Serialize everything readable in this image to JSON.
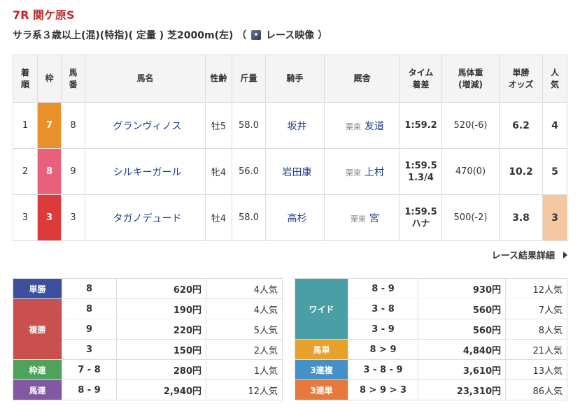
{
  "race": {
    "title": "7R 関ケ原S",
    "condition": "サラ系３歳以上(混)(特指)( 定量 ) 芝2000m(左) （",
    "video_label": "レース映像",
    "condition_close": "）"
  },
  "result_headers": {
    "chaku": [
      "着",
      "順"
    ],
    "waku": "枠",
    "umaban": [
      "馬",
      "番"
    ],
    "name": "馬名",
    "age": "性齢",
    "weight": "斤量",
    "jockey": "騎手",
    "stable": "厩舎",
    "time": [
      "タイム",
      "着差"
    ],
    "bw": [
      "馬体重",
      "(増減)"
    ],
    "odds": [
      "単勝",
      "オッズ"
    ],
    "pop": [
      "人",
      "気"
    ]
  },
  "results": [
    {
      "chaku": "1",
      "waku": "7",
      "waku_color": "#e8902c",
      "umaban": "8",
      "name": "グランヴィノス",
      "age": "牡5",
      "weight": "58.0",
      "jockey": "坂井",
      "region": "栗東",
      "trainer": "友道",
      "time": "1:59.2",
      "margin": "",
      "bw": "520(-6)",
      "odds": "6.2",
      "pop": "4",
      "pop_bg": ""
    },
    {
      "chaku": "2",
      "waku": "8",
      "waku_color": "#e8607a",
      "umaban": "9",
      "name": "シルキーガール",
      "age": "牝4",
      "weight": "56.0",
      "jockey": "岩田康",
      "region": "栗東",
      "trainer": "上村",
      "time": "1:59.5",
      "margin": "1.3/4",
      "bw": "470(0)",
      "odds": "10.2",
      "pop": "5",
      "pop_bg": ""
    },
    {
      "chaku": "3",
      "waku": "3",
      "waku_color": "#dd3b3b",
      "umaban": "3",
      "name": "タガノデュード",
      "age": "牡4",
      "weight": "58.0",
      "jockey": "高杉",
      "region": "栗東",
      "trainer": "宮",
      "time": "1:59.5",
      "margin": "ハナ",
      "bw": "500(-2)",
      "odds": "3.8",
      "pop": "3",
      "pop_bg": "#f4c7a1"
    }
  ],
  "detail_link": "レース結果詳細",
  "payouts_left": [
    {
      "type": "単勝",
      "color": "#3f4fa0",
      "rows": [
        {
          "combo": "8",
          "amount": "620円",
          "ninki": "4人気"
        }
      ]
    },
    {
      "type": "複勝",
      "color": "#c9504f",
      "rows": [
        {
          "combo": "8",
          "amount": "190円",
          "ninki": "4人気"
        },
        {
          "combo": "9",
          "amount": "220円",
          "ninki": "5人気"
        },
        {
          "combo": "3",
          "amount": "150円",
          "ninki": "2人気"
        }
      ]
    },
    {
      "type": "枠連",
      "color": "#4ea35a",
      "rows": [
        {
          "combo": "7 - 8",
          "amount": "280円",
          "ninki": "1人気"
        }
      ]
    },
    {
      "type": "馬連",
      "color": "#8457a3",
      "rows": [
        {
          "combo": "8 - 9",
          "amount": "2,940円",
          "ninki": "12人気"
        }
      ]
    }
  ],
  "payouts_right": [
    {
      "type": "ワイド",
      "color": "#4a9ea5",
      "rows": [
        {
          "combo": "8 - 9",
          "amount": "930円",
          "ninki": "12人気"
        },
        {
          "combo": "3 - 8",
          "amount": "560円",
          "ninki": "7人気"
        },
        {
          "combo": "3 - 9",
          "amount": "560円",
          "ninki": "8人気"
        }
      ]
    },
    {
      "type": "馬単",
      "color": "#e8a22c",
      "rows": [
        {
          "combo": "8 > 9",
          "amount": "4,840円",
          "ninki": "21人気"
        }
      ]
    },
    {
      "type": "3連複",
      "color": "#4690c8",
      "rows": [
        {
          "combo": "3 - 8 - 9",
          "amount": "3,610円",
          "ninki": "13人気"
        }
      ]
    },
    {
      "type": "3連単",
      "color": "#e8793c",
      "rows": [
        {
          "combo": "8 > 9 > 3",
          "amount": "23,310円",
          "ninki": "86人気"
        }
      ]
    }
  ]
}
